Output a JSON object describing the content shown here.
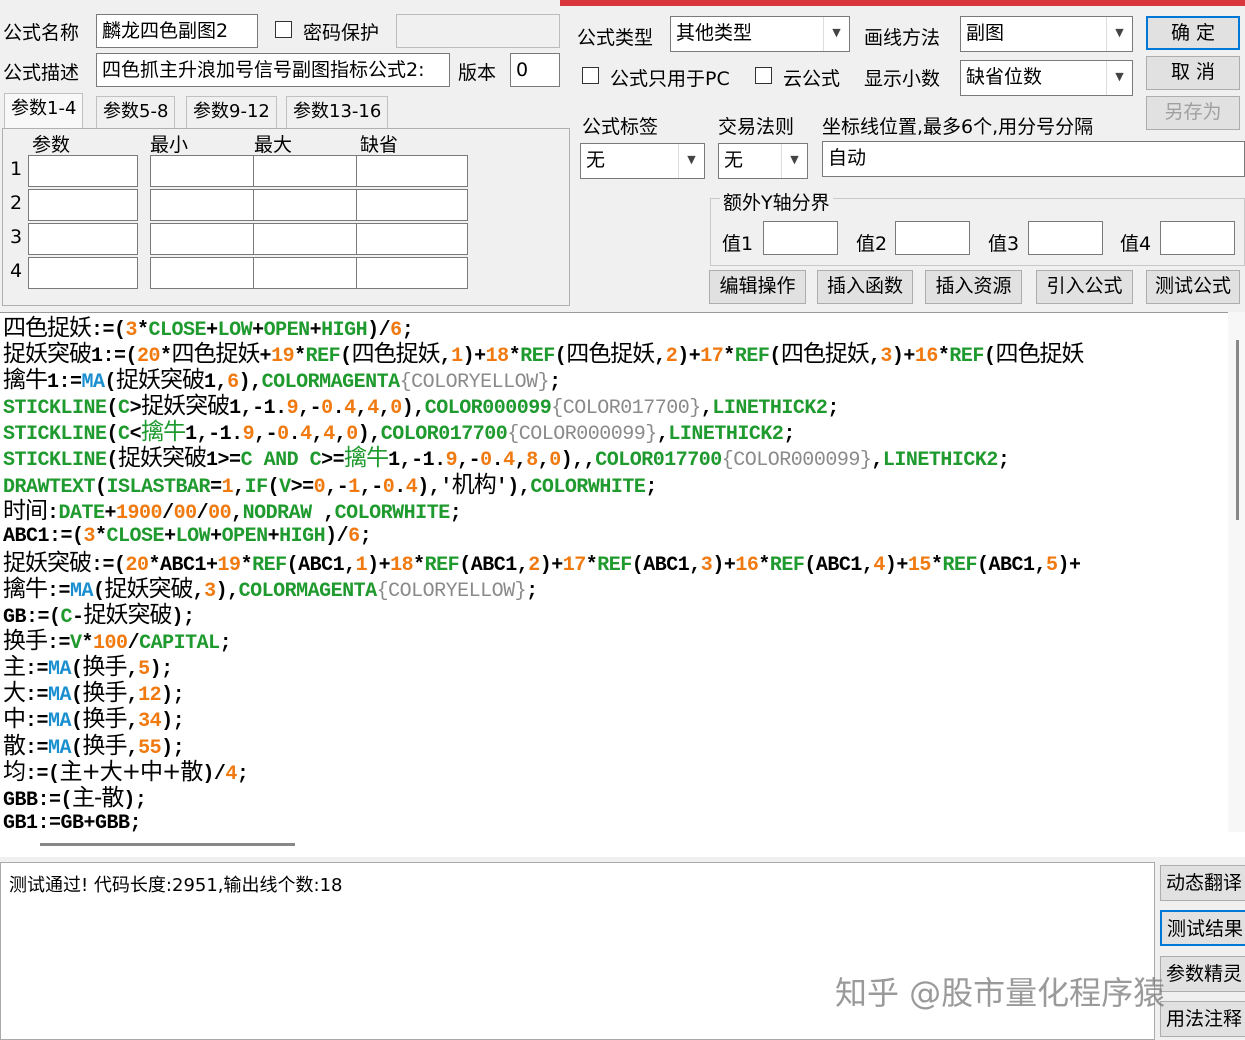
{
  "form": {
    "name_label": "公式名称",
    "name_value": "麟龙四色副图2",
    "password_label": "密码保护",
    "desc_label": "公式描述",
    "desc_value": "四色抓主升浪加号信号副图指标公式2:",
    "version_label": "版本",
    "version_value": "0",
    "type_label": "公式类型",
    "type_value": "其他类型",
    "draw_label": "画线方法",
    "draw_value": "副图",
    "pc_only_label": "公式只用于PC",
    "cloud_label": "云公式",
    "decimals_label": "显示小数",
    "decimals_value": "缺省位数",
    "tag_label": "公式标签",
    "tag_value": "无",
    "rule_label": "交易法则",
    "rule_value": "无",
    "axis_label": "坐标线位置,最多6个,用分号分隔",
    "axis_value": "自动",
    "yaxis_group": "额外Y轴分界",
    "v1": "值1",
    "v2": "值2",
    "v3": "值3",
    "v4": "值4"
  },
  "buttons": {
    "ok": "确  定",
    "cancel": "取  消",
    "saveas": "另存为",
    "edit": "编辑操作",
    "insfunc": "插入函数",
    "insres": "插入资源",
    "import": "引入公式",
    "test": "测试公式"
  },
  "tabs": [
    "参数1-4",
    "参数5-8",
    "参数9-12",
    "参数13-16"
  ],
  "params": {
    "headers": [
      "参数",
      "最小",
      "最大",
      "缺省"
    ],
    "rows": [
      "1",
      "2",
      "3",
      "4"
    ]
  },
  "code": {
    "lines": [
      [
        [
          "t",
          "四色捉妖"
        ],
        [
          "t",
          ":=("
        ],
        [
          "n",
          "3"
        ],
        [
          "t",
          "*"
        ],
        [
          "k",
          "CLOSE"
        ],
        [
          "t",
          "+"
        ],
        [
          "k",
          "LOW"
        ],
        [
          "t",
          "+"
        ],
        [
          "k",
          "OPEN"
        ],
        [
          "t",
          "+"
        ],
        [
          "k",
          "HIGH"
        ],
        [
          "t",
          ")/"
        ],
        [
          "n",
          "6"
        ],
        [
          "t",
          ";"
        ]
      ],
      [
        [
          "t",
          "捉妖突破"
        ],
        [
          "t",
          "1:=("
        ],
        [
          "n",
          "20"
        ],
        [
          "t",
          "*"
        ],
        [
          "t",
          "四色捉妖"
        ],
        [
          "t",
          "+"
        ],
        [
          "n",
          "19"
        ],
        [
          "t",
          "*"
        ],
        [
          "k",
          "REF"
        ],
        [
          "t",
          "("
        ],
        [
          "t",
          "四色捉妖"
        ],
        [
          "t",
          ","
        ],
        [
          "n",
          "1"
        ],
        [
          "t",
          ")+"
        ],
        [
          "n",
          "18"
        ],
        [
          "t",
          "*"
        ],
        [
          "k",
          "REF"
        ],
        [
          "t",
          "("
        ],
        [
          "t",
          "四色捉妖"
        ],
        [
          "t",
          ","
        ],
        [
          "n",
          "2"
        ],
        [
          "t",
          ")+"
        ],
        [
          "n",
          "17"
        ],
        [
          "t",
          "*"
        ],
        [
          "k",
          "REF"
        ],
        [
          "t",
          "("
        ],
        [
          "t",
          "四色捉妖"
        ],
        [
          "t",
          ","
        ],
        [
          "n",
          "3"
        ],
        [
          "t",
          ")+"
        ],
        [
          "n",
          "16"
        ],
        [
          "t",
          "*"
        ],
        [
          "k",
          "REF"
        ],
        [
          "t",
          "("
        ],
        [
          "t",
          "四色捉妖"
        ]
      ],
      [
        [
          "t",
          "擒牛"
        ],
        [
          "t",
          "1:="
        ],
        [
          "f",
          "MA"
        ],
        [
          "t",
          "("
        ],
        [
          "t",
          "捉妖突破"
        ],
        [
          "t",
          "1,"
        ],
        [
          "n",
          "6"
        ],
        [
          "t",
          "),"
        ],
        [
          "k",
          "COLORMAGENTA"
        ],
        [
          "g",
          "{COLORYELLOW}"
        ],
        [
          "t",
          ";"
        ]
      ],
      [
        [
          "k",
          "STICKLINE"
        ],
        [
          "t",
          "("
        ],
        [
          "k",
          "C"
        ],
        [
          "t",
          ">"
        ],
        [
          "t",
          "捉妖突破"
        ],
        [
          "t",
          "1,-1."
        ],
        [
          "n",
          "9"
        ],
        [
          "t",
          ",-"
        ],
        [
          "n",
          "0"
        ],
        [
          "t",
          "."
        ],
        [
          "n",
          "4"
        ],
        [
          "t",
          ","
        ],
        [
          "n",
          "4"
        ],
        [
          "t",
          ","
        ],
        [
          "n",
          "0"
        ],
        [
          "t",
          "),"
        ],
        [
          "k",
          "COLOR000099"
        ],
        [
          "g",
          "{COLOR017700}"
        ],
        [
          "t",
          ","
        ],
        [
          "k",
          "LINETHICK2"
        ],
        [
          "t",
          ";"
        ]
      ],
      [
        [
          "k",
          "STICKLINE"
        ],
        [
          "t",
          "("
        ],
        [
          "k",
          "C"
        ],
        [
          "t",
          "<"
        ],
        [
          "c",
          "擒牛"
        ],
        [
          "t",
          "1,-1."
        ],
        [
          "n",
          "9"
        ],
        [
          "t",
          ",-"
        ],
        [
          "n",
          "0"
        ],
        [
          "t",
          "."
        ],
        [
          "n",
          "4"
        ],
        [
          "t",
          ","
        ],
        [
          "n",
          "4"
        ],
        [
          "t",
          ","
        ],
        [
          "n",
          "0"
        ],
        [
          "t",
          "),"
        ],
        [
          "k",
          "COLOR017700"
        ],
        [
          "g",
          "{COLOR000099}"
        ],
        [
          "t",
          ","
        ],
        [
          "k",
          "LINETHICK2"
        ],
        [
          "t",
          ";"
        ]
      ],
      [
        [
          "k",
          "STICKLINE"
        ],
        [
          "t",
          "("
        ],
        [
          "t",
          "捉妖突破"
        ],
        [
          "t",
          "1>="
        ],
        [
          "k",
          "C AND C"
        ],
        [
          "t",
          ">="
        ],
        [
          "c",
          "擒牛"
        ],
        [
          "t",
          "1,-1."
        ],
        [
          "n",
          "9"
        ],
        [
          "t",
          ",-"
        ],
        [
          "n",
          "0"
        ],
        [
          "t",
          "."
        ],
        [
          "n",
          "4"
        ],
        [
          "t",
          ","
        ],
        [
          "n",
          "8"
        ],
        [
          "t",
          ","
        ],
        [
          "n",
          "0"
        ],
        [
          "t",
          "),,"
        ],
        [
          "k",
          "COLOR017700"
        ],
        [
          "g",
          "{COLOR000099}"
        ],
        [
          "t",
          ","
        ],
        [
          "k",
          "LINETHICK2"
        ],
        [
          "t",
          ";"
        ]
      ],
      [
        [
          "k",
          "DRAWTEXT"
        ],
        [
          "t",
          "("
        ],
        [
          "k",
          "ISLASTBAR"
        ],
        [
          "t",
          "="
        ],
        [
          "n",
          "1"
        ],
        [
          "t",
          ","
        ],
        [
          "k",
          "IF"
        ],
        [
          "t",
          "("
        ],
        [
          "k",
          "V"
        ],
        [
          "t",
          ">="
        ],
        [
          "n",
          "0"
        ],
        [
          "t",
          ",-"
        ],
        [
          "n",
          "1"
        ],
        [
          "t",
          ",-"
        ],
        [
          "n",
          "0"
        ],
        [
          "t",
          "."
        ],
        [
          "n",
          "4"
        ],
        [
          "t",
          "),'"
        ],
        [
          "t",
          "机构"
        ],
        [
          "t",
          "'),"
        ],
        [
          "k",
          "COLORWHITE"
        ],
        [
          "t",
          ";"
        ]
      ],
      [
        [
          "t",
          "时间"
        ],
        [
          "t",
          ":"
        ],
        [
          "k",
          "DATE"
        ],
        [
          "t",
          "+"
        ],
        [
          "n",
          "1900"
        ],
        [
          "t",
          "/"
        ],
        [
          "n",
          "00"
        ],
        [
          "t",
          "/"
        ],
        [
          "n",
          "00"
        ],
        [
          "t",
          ","
        ],
        [
          "k",
          "NODRAW"
        ],
        [
          "t",
          " ,"
        ],
        [
          "k",
          "COLORWHITE"
        ],
        [
          "t",
          ";"
        ]
      ],
      [
        [
          "t",
          "ABC1:=("
        ],
        [
          "n",
          "3"
        ],
        [
          "t",
          "*"
        ],
        [
          "k",
          "CLOSE"
        ],
        [
          "t",
          "+"
        ],
        [
          "k",
          "LOW"
        ],
        [
          "t",
          "+"
        ],
        [
          "k",
          "OPEN"
        ],
        [
          "t",
          "+"
        ],
        [
          "k",
          "HIGH"
        ],
        [
          "t",
          ")/"
        ],
        [
          "n",
          "6"
        ],
        [
          "t",
          ";"
        ]
      ],
      [
        [
          "t",
          "捉妖突破"
        ],
        [
          "t",
          ":=("
        ],
        [
          "n",
          "20"
        ],
        [
          "t",
          "*ABC1+"
        ],
        [
          "n",
          "19"
        ],
        [
          "t",
          "*"
        ],
        [
          "k",
          "REF"
        ],
        [
          "t",
          "(ABC1,"
        ],
        [
          "n",
          "1"
        ],
        [
          "t",
          ")+"
        ],
        [
          "n",
          "18"
        ],
        [
          "t",
          "*"
        ],
        [
          "k",
          "REF"
        ],
        [
          "t",
          "(ABC1,"
        ],
        [
          "n",
          "2"
        ],
        [
          "t",
          ")+"
        ],
        [
          "n",
          "17"
        ],
        [
          "t",
          "*"
        ],
        [
          "k",
          "REF"
        ],
        [
          "t",
          "(ABC1,"
        ],
        [
          "n",
          "3"
        ],
        [
          "t",
          ")+"
        ],
        [
          "n",
          "16"
        ],
        [
          "t",
          "*"
        ],
        [
          "k",
          "REF"
        ],
        [
          "t",
          "(ABC1,"
        ],
        [
          "n",
          "4"
        ],
        [
          "t",
          ")+"
        ],
        [
          "n",
          "15"
        ],
        [
          "t",
          "*"
        ],
        [
          "k",
          "REF"
        ],
        [
          "t",
          "(ABC1,"
        ],
        [
          "n",
          "5"
        ],
        [
          "t",
          ")+"
        ]
      ],
      [
        [
          "t",
          "擒牛"
        ],
        [
          "t",
          ":="
        ],
        [
          "f",
          "MA"
        ],
        [
          "t",
          "("
        ],
        [
          "t",
          "捉妖突破"
        ],
        [
          "t",
          ","
        ],
        [
          "n",
          "3"
        ],
        [
          "t",
          "),"
        ],
        [
          "k",
          "COLORMAGENTA"
        ],
        [
          "g",
          "{COLORYELLOW}"
        ],
        [
          "t",
          ";"
        ]
      ],
      [
        [
          "t",
          "GB:=("
        ],
        [
          "k",
          "C"
        ],
        [
          "t",
          "-"
        ],
        [
          "t",
          "捉妖突破"
        ],
        [
          "t",
          ");"
        ]
      ],
      [
        [
          "t",
          "换手"
        ],
        [
          "t",
          ":="
        ],
        [
          "k",
          "V"
        ],
        [
          "t",
          "*"
        ],
        [
          "n",
          "100"
        ],
        [
          "t",
          "/"
        ],
        [
          "k",
          "CAPITAL"
        ],
        [
          "t",
          ";"
        ]
      ],
      [
        [
          "t",
          "主"
        ],
        [
          "t",
          ":="
        ],
        [
          "f",
          "MA"
        ],
        [
          "t",
          "("
        ],
        [
          "t",
          "换手"
        ],
        [
          "t",
          ","
        ],
        [
          "n",
          "5"
        ],
        [
          "t",
          ");"
        ]
      ],
      [
        [
          "t",
          "大"
        ],
        [
          "t",
          ":="
        ],
        [
          "f",
          "MA"
        ],
        [
          "t",
          "("
        ],
        [
          "t",
          "换手"
        ],
        [
          "t",
          ","
        ],
        [
          "n",
          "12"
        ],
        [
          "t",
          ");"
        ]
      ],
      [
        [
          "t",
          "中"
        ],
        [
          "t",
          ":="
        ],
        [
          "f",
          "MA"
        ],
        [
          "t",
          "("
        ],
        [
          "t",
          "换手"
        ],
        [
          "t",
          ","
        ],
        [
          "n",
          "34"
        ],
        [
          "t",
          ");"
        ]
      ],
      [
        [
          "t",
          "散"
        ],
        [
          "t",
          ":="
        ],
        [
          "f",
          "MA"
        ],
        [
          "t",
          "("
        ],
        [
          "t",
          "换手"
        ],
        [
          "t",
          ","
        ],
        [
          "n",
          "55"
        ],
        [
          "t",
          ");"
        ]
      ],
      [
        [
          "t",
          "均"
        ],
        [
          "t",
          ":=("
        ],
        [
          "t",
          "主+大+中+散"
        ],
        [
          "t",
          ")/"
        ],
        [
          "n",
          "4"
        ],
        [
          "t",
          ";"
        ]
      ],
      [
        [
          "t",
          "GBB:=("
        ],
        [
          "t",
          "主-散"
        ],
        [
          "t",
          ");"
        ]
      ],
      [
        [
          "t",
          "GB1:=GB+GBB;"
        ]
      ]
    ]
  },
  "output": {
    "text": "测试通过! 代码长度:2951,输出线个数:18"
  },
  "side_buttons": [
    "动态翻译",
    "测试结果",
    "参数精灵",
    "用法注释"
  ],
  "watermark": "知乎 @股市量化程序猿",
  "colors": {
    "keyword": "#1f9a2e",
    "number": "#f07a10",
    "function": "#1a8fd0",
    "comment": "#8a8a8a",
    "accent": "#d9363e"
  }
}
